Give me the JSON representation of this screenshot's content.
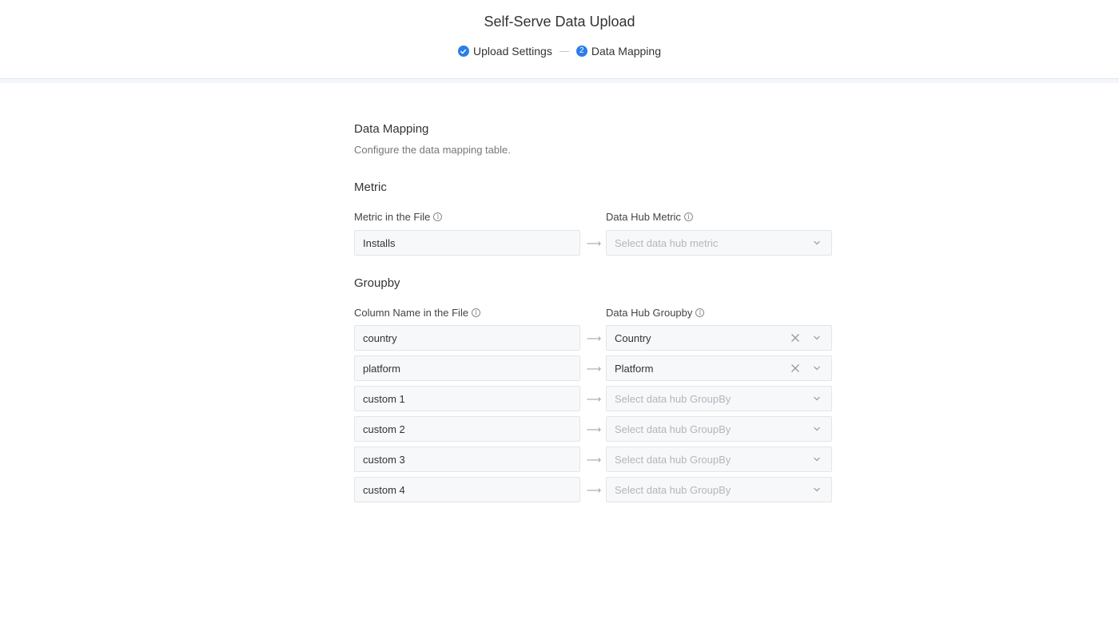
{
  "header": {
    "title": "Self-Serve Data Upload",
    "steps": [
      {
        "label": "Upload Settings",
        "state": "done",
        "icon": "check-icon"
      },
      {
        "label": "Data Mapping",
        "state": "current",
        "number": "2"
      }
    ]
  },
  "mapping": {
    "title": "Data Mapping",
    "description": "Configure the data mapping table.",
    "metric": {
      "title": "Metric",
      "left_label": "Metric in the File",
      "right_label": "Data Hub Metric",
      "rows": [
        {
          "source": "Installs",
          "value": "",
          "placeholder": "Select data hub metric"
        }
      ]
    },
    "groupby": {
      "title": "Groupby",
      "left_label": "Column Name in the File",
      "right_label": "Data Hub Groupby",
      "rows": [
        {
          "source": "country",
          "value": "Country",
          "placeholder": ""
        },
        {
          "source": "platform",
          "value": "Platform",
          "placeholder": ""
        },
        {
          "source": "custom 1",
          "value": "",
          "placeholder": "Select data hub GroupBy"
        },
        {
          "source": "custom 2",
          "value": "",
          "placeholder": "Select data hub GroupBy"
        },
        {
          "source": "custom 3",
          "value": "",
          "placeholder": "Select data hub GroupBy"
        },
        {
          "source": "custom 4",
          "value": "",
          "placeholder": "Select data hub GroupBy"
        }
      ]
    }
  },
  "colors": {
    "accent": "#2b7de9",
    "field_bg": "#f7f8fa",
    "field_border": "#e3e5e8",
    "placeholder": "#b3b6bb"
  },
  "arrow_glyph": "⟶"
}
